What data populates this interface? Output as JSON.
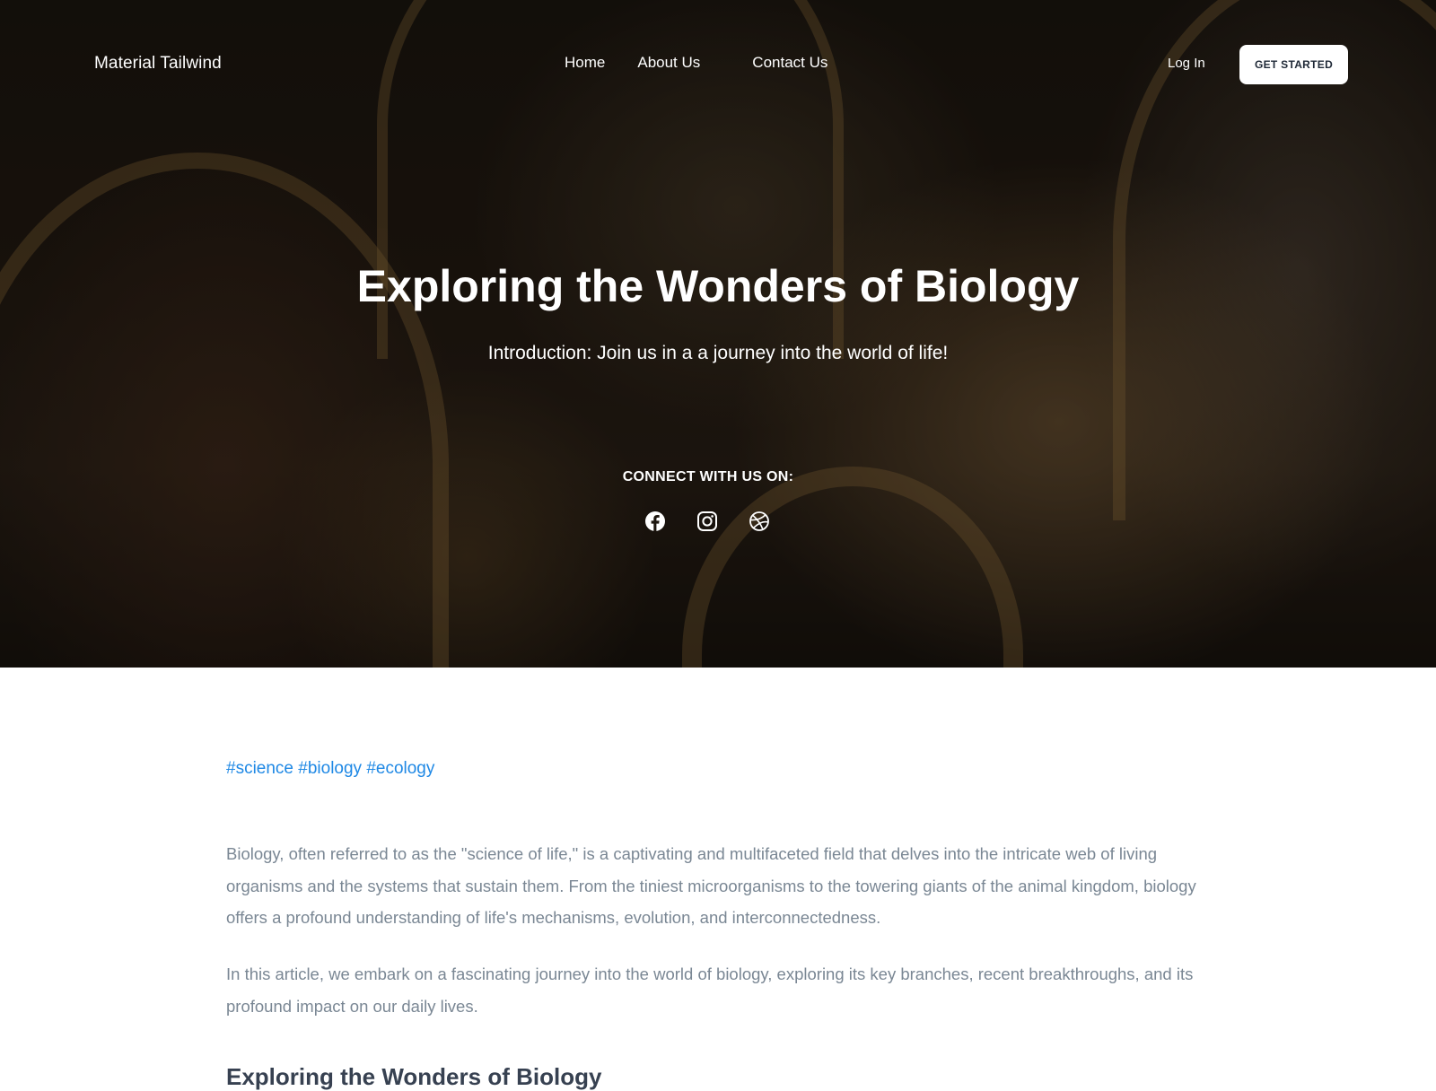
{
  "nav": {
    "brand": "Material Tailwind",
    "links": [
      "Home",
      "About Us",
      "Contact Us"
    ],
    "login": "Log In",
    "cta": "GET STARTED"
  },
  "hero": {
    "title": "Exploring the Wonders of Biology",
    "subtitle": "Introduction: Join us in a a journey into the world of life!",
    "connect_label": "CONNECT WITH US ON:",
    "socials": [
      "facebook-icon",
      "instagram-icon",
      "dribbble-icon"
    ]
  },
  "article": {
    "tags": "#science #biology #ecology",
    "paragraphs": [
      "Biology, often referred to as the \"science of life,\" is a captivating and multifaceted field that delves into the intricate web of living organisms and the systems that sustain them. From the tiniest microorganisms to the towering giants of the animal kingdom, biology offers a profound understanding of life's mechanisms, evolution, and interconnectedness.",
      " In this article, we embark on a fascinating journey into the world of biology, exploring its key branches, recent breakthroughs, and its profound impact on our daily lives."
    ],
    "heading": "Exploring the Wonders of Biology"
  },
  "colors": {
    "tag_blue": "#1e88e5",
    "body_text": "#7a8794",
    "heading_text": "#374151"
  }
}
